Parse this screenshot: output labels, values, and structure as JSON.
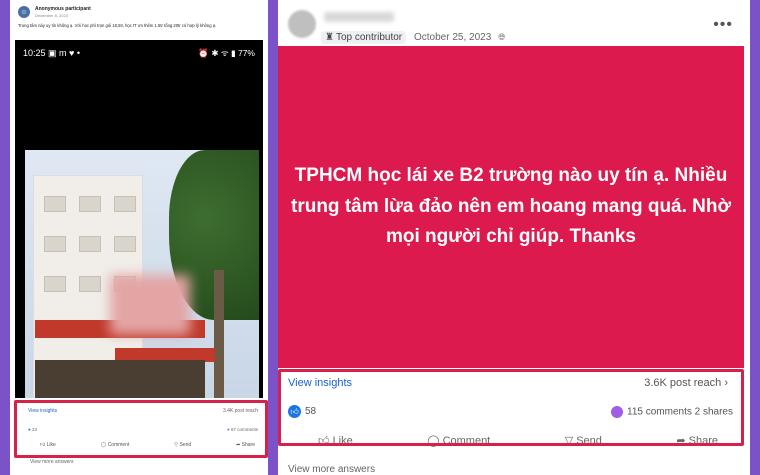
{
  "left_post": {
    "author": "Anonymous participant",
    "date": "December 8, 2023",
    "text": "Trung tâm này uy tín không ạ. Với học phí trọn gói 18,5tr, học tT ơn thêm 1.5tr tổng 20tr có hợp lý không ạ.",
    "phone_time": "10:25",
    "phone_status_left": "▣ m ♥ •",
    "phone_status_right": "⏰ ✱ ᯤ ▮ 77%",
    "view_insights": "View insights",
    "post_reach": "3.4K post reach",
    "reactions_count": "23",
    "comments_count": "67 comments",
    "actions": {
      "like": "Like",
      "comment": "Comment",
      "send": "Send",
      "share": "Share"
    },
    "view_more": "View more answers"
  },
  "right_post": {
    "badge": "Top contributor",
    "date": "October 25, 2023",
    "banner_text": "TPHCM học lái xe B2 trường nào uy tín ạ. Nhiều trung tâm lừa đảo nên em hoang mang quá. Nhờ mọi người chỉ giúp. Thanks",
    "banner_color": "#dc1a4e",
    "view_insights": "View insights",
    "post_reach": "3.6K post reach",
    "reactions_count": "58",
    "comments_count": "115 comments",
    "shares_count": "2 shares",
    "actions": {
      "like": "Like",
      "comment": "Comment",
      "send": "Send",
      "share": "Share"
    },
    "view_more": "View more answers"
  },
  "highlight_color": "#d6224a",
  "background_color": "#7b52c8"
}
